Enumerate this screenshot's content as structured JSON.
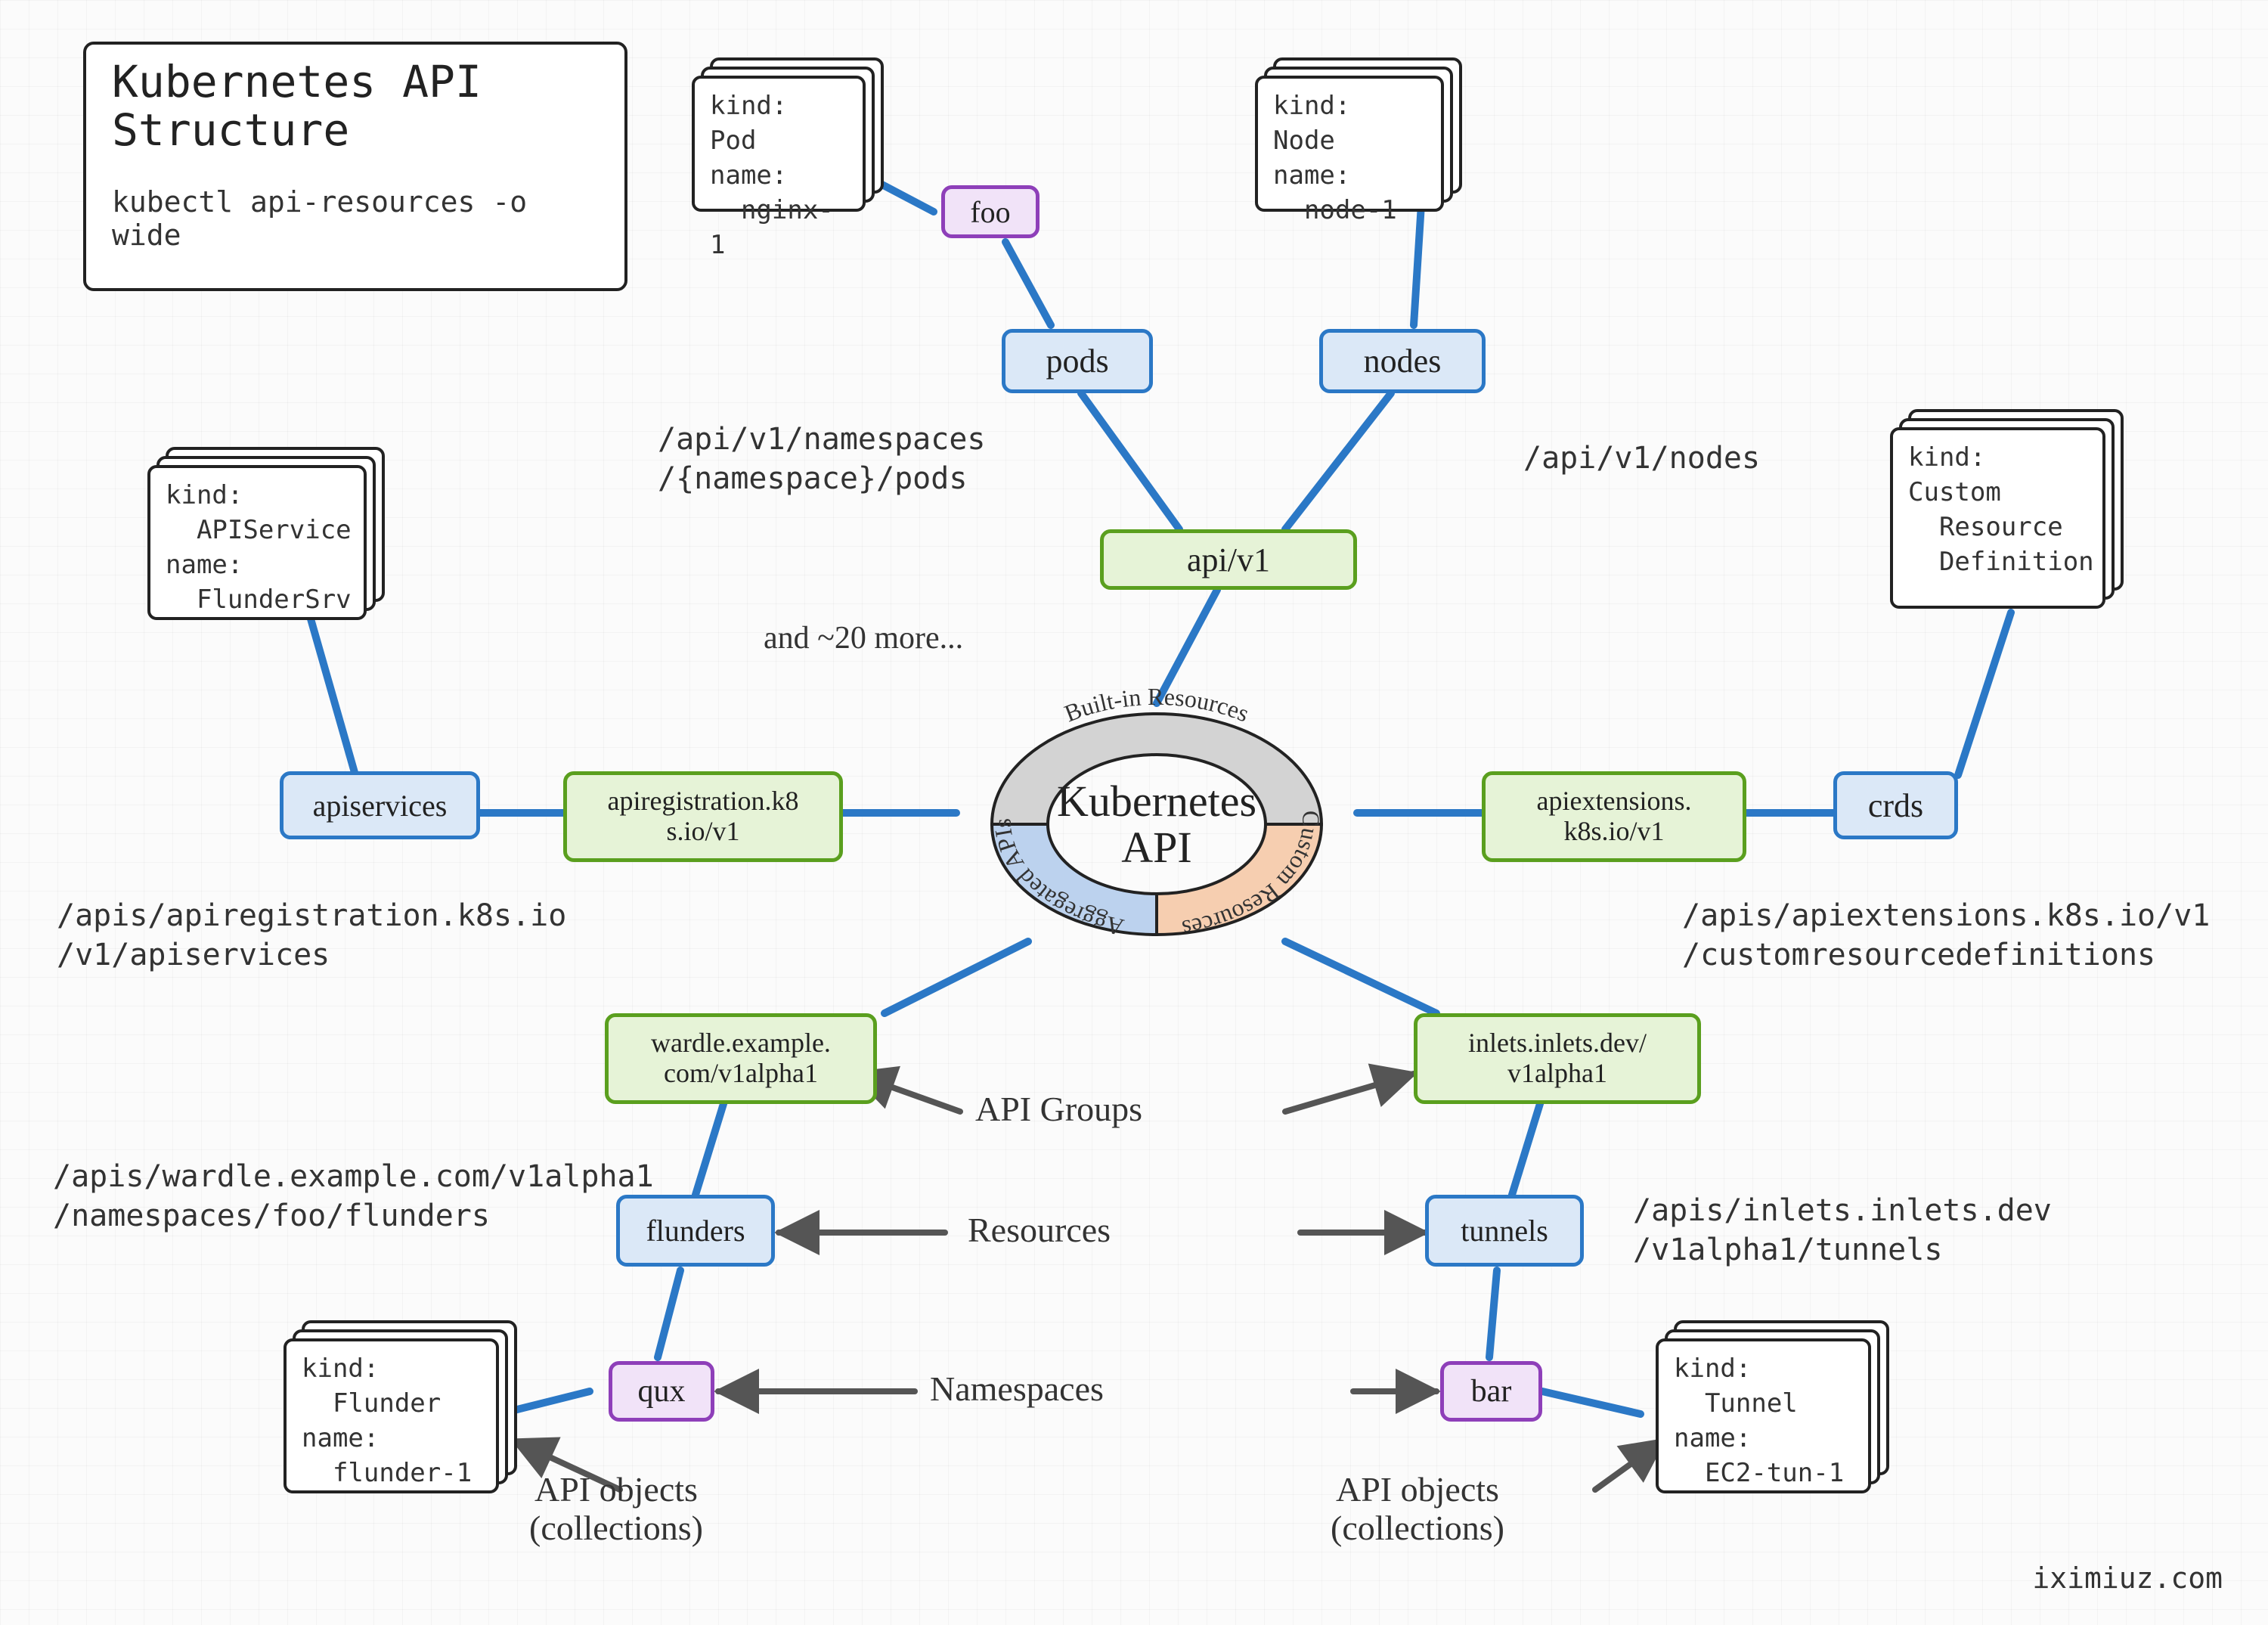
{
  "title_box": {
    "title": "Kubernetes API\nStructure",
    "cmd": "kubectl api-resources -o wide"
  },
  "objects": {
    "pod": {
      "kind": "Pod",
      "name_label": "name:",
      "name": "nginx-1"
    },
    "node": {
      "kind": "Node",
      "name_label": "name:",
      "name": "node-1"
    },
    "apiservice": {
      "kind": "APIService",
      "name_label": "name:",
      "name": "FlunderSrv"
    },
    "crd": {
      "kind": "Custom\n  Resource\n  Definition"
    },
    "flunder": {
      "kind": "Flunder",
      "name_label": "name:",
      "name": "flunder-1"
    },
    "tunnel": {
      "kind": "Tunnel",
      "name_label": "name:",
      "name": "EC2-tun-1"
    }
  },
  "resources": {
    "pods": "pods",
    "nodes": "nodes",
    "apiservices": "apiservices",
    "crds": "crds",
    "flunders": "flunders",
    "tunnels": "tunnels"
  },
  "namespaces": {
    "foo": "foo",
    "qux": "qux",
    "bar": "bar"
  },
  "groups": {
    "core": "api/v1",
    "apireg": "apiregistration.k8\ns.io/v1",
    "apiext": "apiextensions.\nk8s.io/v1",
    "wardle": "wardle.example.\ncom/v1alpha1",
    "inlets": "inlets.inlets.dev/\nv1alpha1"
  },
  "paths": {
    "pods": "/api/v1/namespaces\n/{namespace}/pods",
    "nodes": "/api/v1/nodes",
    "apiservices": "/apis/apiregistration.k8s.io\n/v1/apiservices",
    "crds": "/apis/apiextensions.k8s.io/v1\n/customresourcedefinitions",
    "flunders": "/apis/wardle.example.com/v1alpha1\n/namespaces/foo/flunders",
    "tunnels": "/apis/inlets.inlets.dev\n/v1alpha1/tunnels"
  },
  "center": {
    "title": "Kubernetes\nAPI",
    "seg_builtin": "Built-in\nResources",
    "seg_agg": "Aggregated\nAPIs",
    "seg_custom": "Custom\nResources"
  },
  "legend": {
    "more": "and ~20 more...",
    "api_groups": "API Groups",
    "resources": "Resources",
    "namespaces": "Namespaces",
    "objects_left": "API objects\n(collections)",
    "objects_right": "API objects\n(collections)"
  },
  "credit": "iximiuz.com"
}
